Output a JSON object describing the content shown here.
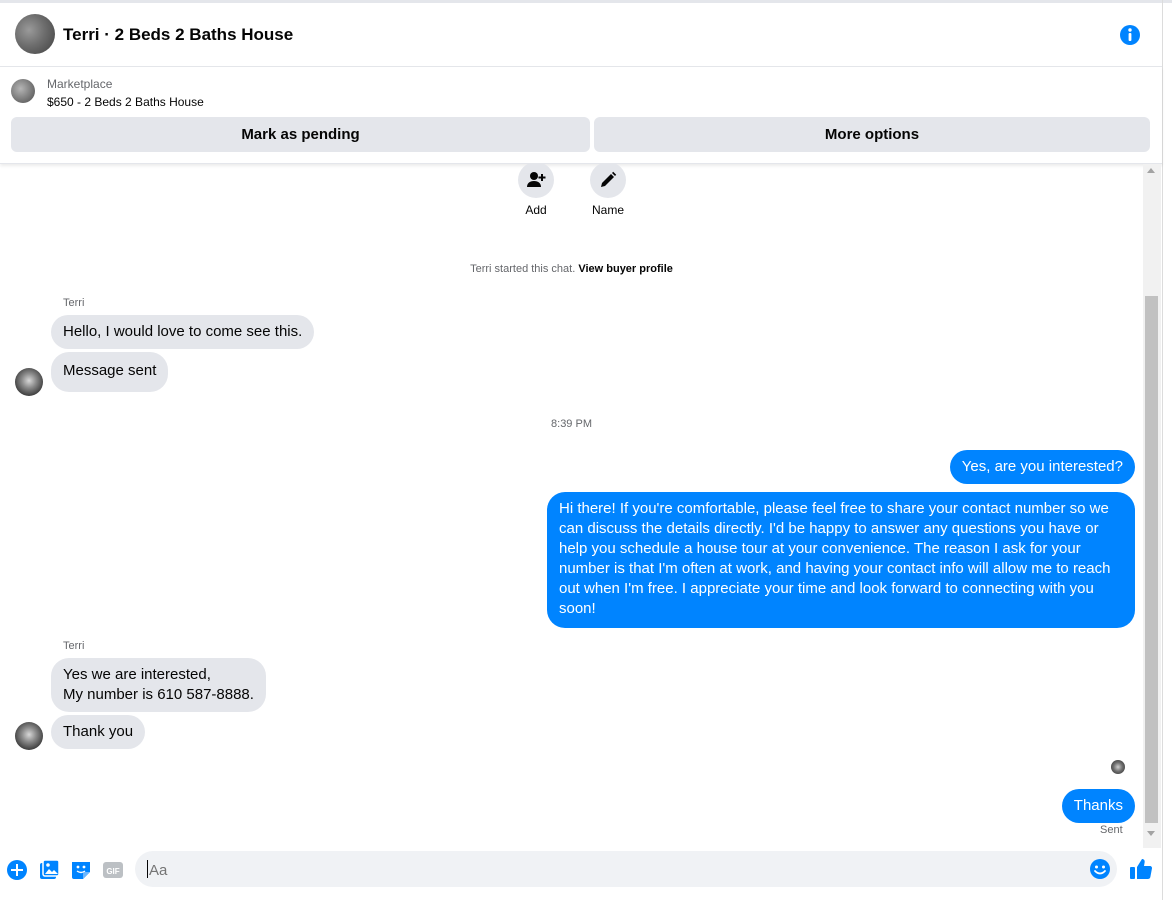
{
  "header": {
    "title": "Terri · 2 Beds 2 Baths House"
  },
  "marketplace": {
    "label": "Marketplace",
    "item": "$650 - 2 Beds 2 Baths House",
    "mark_pending": "Mark as pending",
    "more_options": "More options"
  },
  "actions": {
    "add_label": "Add",
    "name_label": "Name"
  },
  "system_note": {
    "text": "Terri started this chat. ",
    "link": "View buyer profile"
  },
  "messages": {
    "sender_1": "Terri",
    "in_1": "Hello, I would love to come see this.",
    "in_2": "Message sent",
    "timestamp": "8:39 PM",
    "out_1": "Yes, are you interested?",
    "out_2": "Hi there! If you're comfortable, please feel free to share your contact number so we can discuss the details directly. I'd be happy to answer any questions you have or help you schedule a house tour at your convenience. The reason I ask for your number is that I'm often at work, and having your contact info will allow me to reach out when I'm free. I appreciate your time and look forward to connecting with you soon!",
    "sender_2": "Terri",
    "in_3": "Yes  we are interested,\nMy number is 610 587-8888.",
    "in_4": "Thank you",
    "out_3": "Thanks",
    "status": "Sent"
  },
  "composer": {
    "placeholder": "Aa"
  },
  "colors": {
    "accent": "#0084ff",
    "bubble_in": "#e4e6eb",
    "muted_text": "#65676b"
  }
}
